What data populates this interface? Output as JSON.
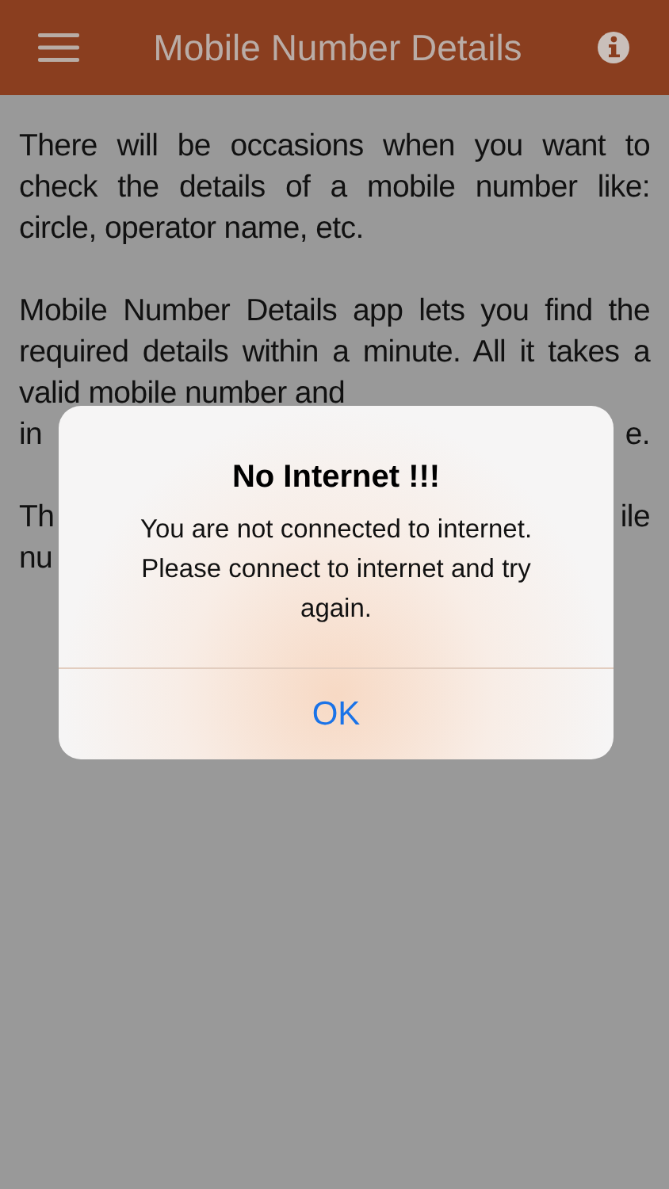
{
  "header": {
    "title": "Mobile Number Details"
  },
  "content": {
    "paragraphs": [
      "There will be occasions when you want to check the details of a mobile number like: circle, operator name, etc.",
      "Mobile Number Details app lets you find the required details within a minute. All it takes a valid mobile number and"
    ],
    "covered_paragraphs": [
      [
        {
          "left": "in",
          "right": "e."
        }
      ],
      [
        {
          "left": "Th",
          "right": "ile"
        },
        {
          "left": "nu"
        }
      ]
    ]
  },
  "alert": {
    "title": "No Internet !!!",
    "message": "You are not connected to internet. Please connect to internet and try again.",
    "buttons": [
      {
        "label": "OK"
      }
    ]
  }
}
